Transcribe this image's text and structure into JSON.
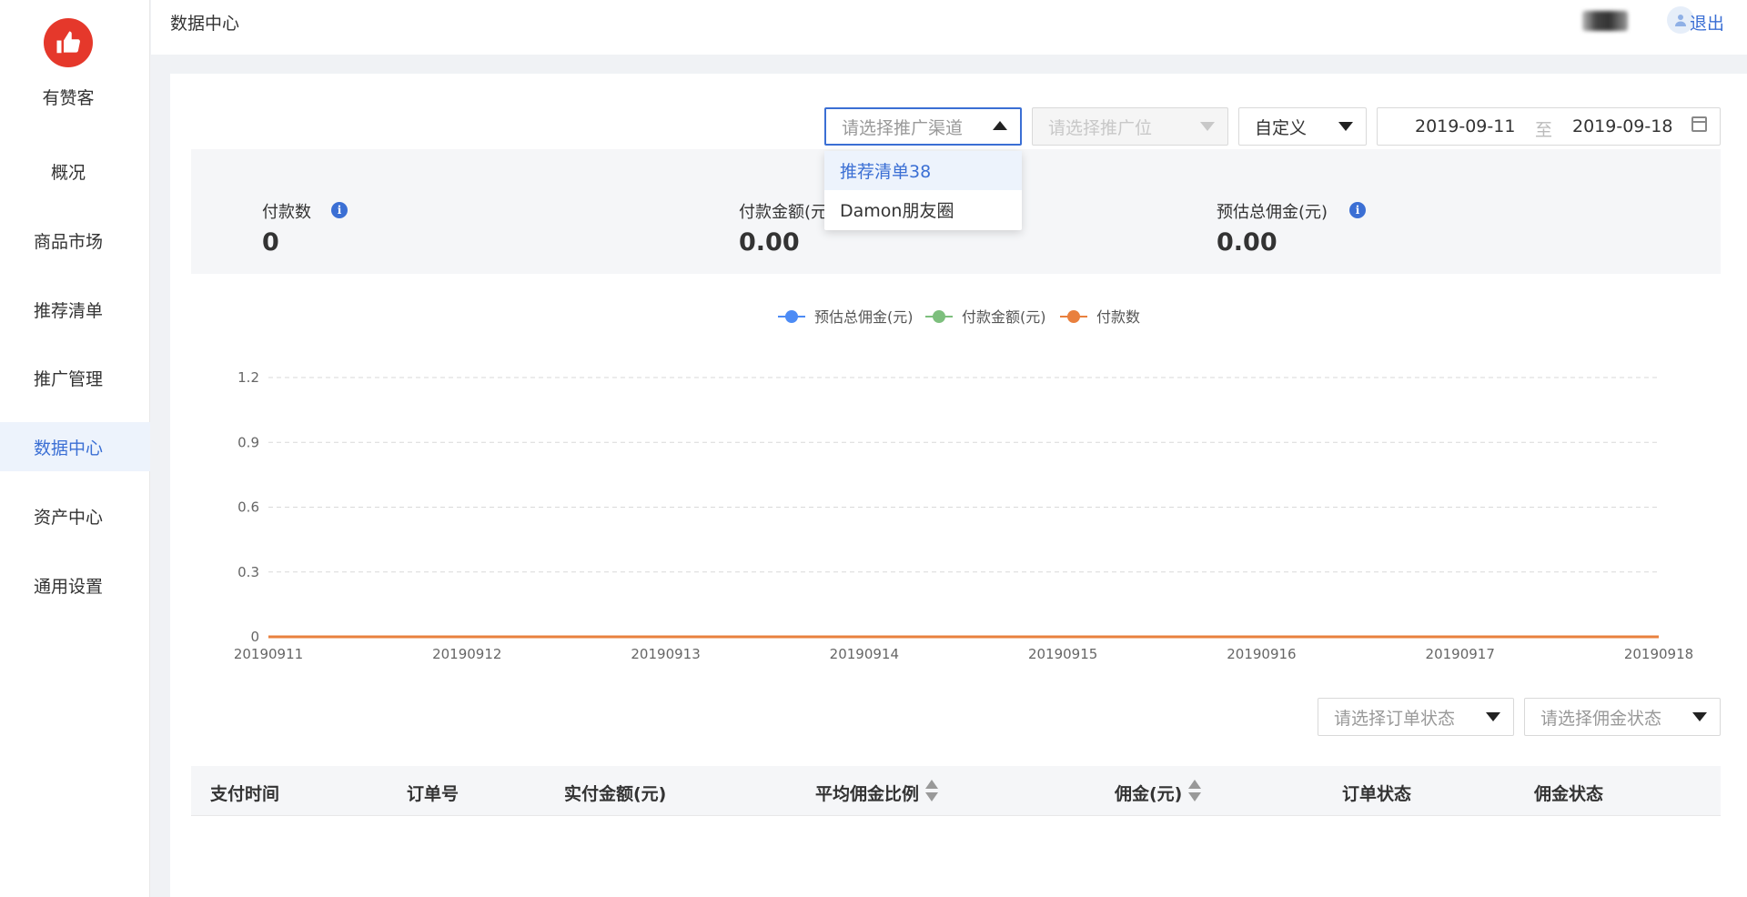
{
  "sidebar": {
    "brand": "有赞客",
    "items": [
      {
        "label": "概况"
      },
      {
        "label": "商品市场"
      },
      {
        "label": "推荐清单"
      },
      {
        "label": "推广管理"
      },
      {
        "label": "数据中心",
        "active": true
      },
      {
        "label": "资产中心"
      },
      {
        "label": "通用设置"
      }
    ]
  },
  "header": {
    "title": "数据中心",
    "logout": "退出"
  },
  "filters": {
    "channel_placeholder": "请选择推广渠道",
    "position_placeholder": "请选择推广位",
    "range_type": "自定义",
    "date_start": "2019-09-11",
    "date_sep": "至",
    "date_end": "2019-09-18"
  },
  "channel_dropdown": {
    "options": [
      "推荐清单38",
      "Damon朋友圈"
    ]
  },
  "stats": [
    {
      "label": "付款数",
      "value": "0"
    },
    {
      "label": "付款金额(元)",
      "value": "0.00"
    },
    {
      "label": "预估总佣金(元)",
      "value": "0.00"
    }
  ],
  "colors": {
    "accent": "#3b6fd4",
    "logo": "#e5382b",
    "series_commission": "#4c8bf5",
    "series_amount": "#7dbf7d",
    "series_count": "#e9803e"
  },
  "chart_data": {
    "type": "line",
    "x": [
      "20190911",
      "20190912",
      "20190913",
      "20190914",
      "20190915",
      "20190916",
      "20190917",
      "20190918"
    ],
    "yticks": [
      "0",
      "0.3",
      "0.6",
      "0.9",
      "1.2"
    ],
    "ylim": [
      0,
      1.2
    ],
    "grid": true,
    "legend_position": "top-center",
    "series": [
      {
        "name": "预估总佣金(元)",
        "values": [
          0,
          0,
          0,
          0,
          0,
          0,
          0,
          0
        ],
        "color": "#4c8bf5"
      },
      {
        "name": "付款金额(元)",
        "values": [
          0,
          0,
          0,
          0,
          0,
          0,
          0,
          0
        ],
        "color": "#7dbf7d"
      },
      {
        "name": "付款数",
        "values": [
          0,
          0,
          0,
          0,
          0,
          0,
          0,
          0
        ],
        "color": "#e9803e"
      }
    ]
  },
  "table_filters": {
    "order_status_placeholder": "请选择订单状态",
    "commission_status_placeholder": "请选择佣金状态"
  },
  "table": {
    "columns": [
      "支付时间",
      "订单号",
      "实付金额(元)",
      "平均佣金比例",
      "佣金(元)",
      "订单状态",
      "佣金状态"
    ]
  }
}
